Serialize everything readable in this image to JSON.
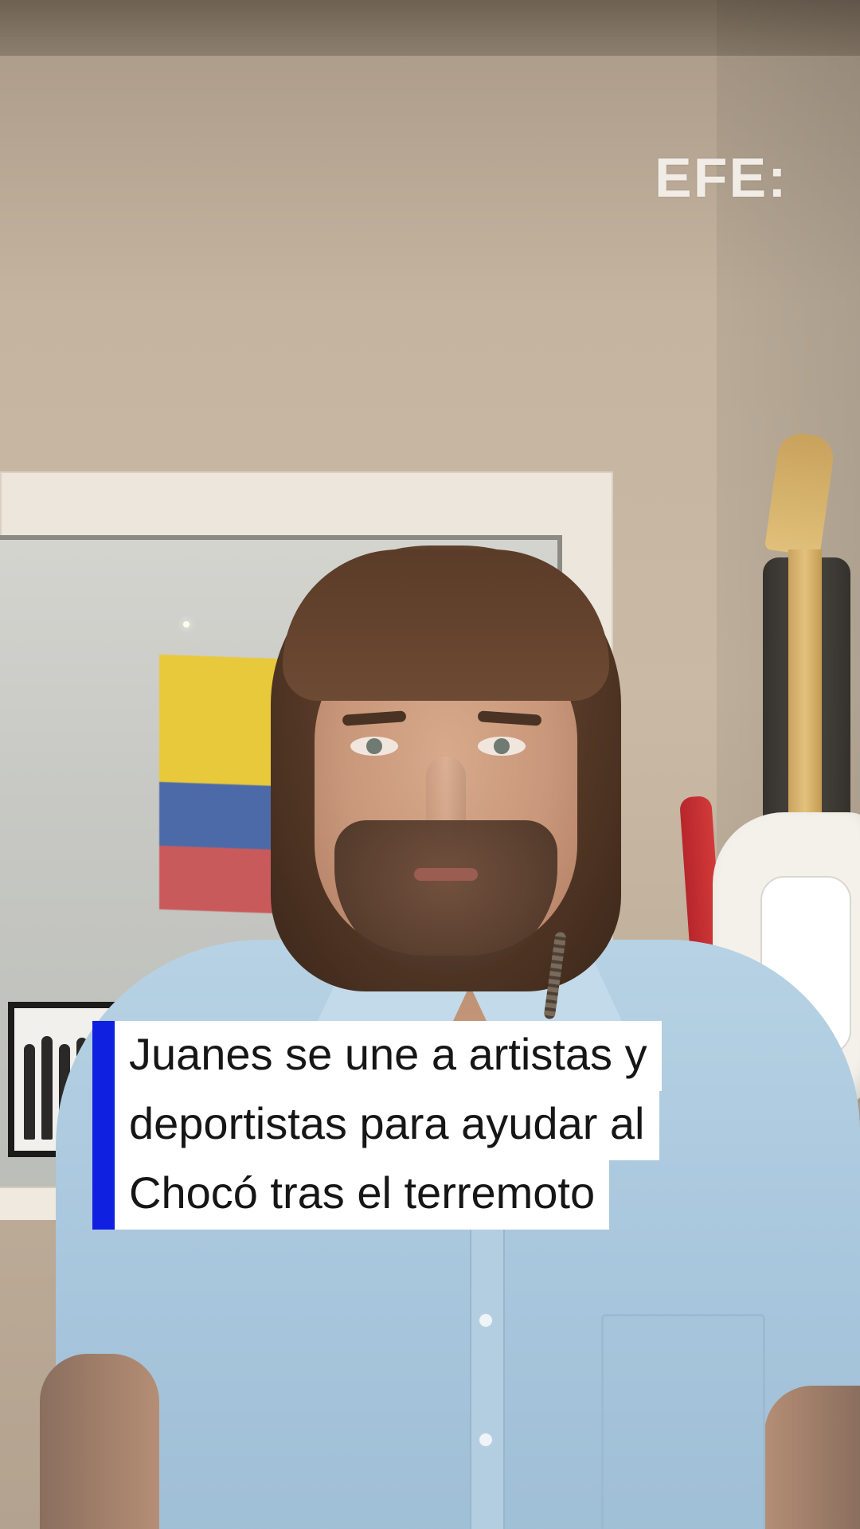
{
  "logo": {
    "text": "EFE:"
  },
  "caption": {
    "lines": [
      "Juanes se une a artistas y",
      "deportistas para ayudar al",
      "Chocó tras el terremoto"
    ],
    "accent_color": "#1020e0",
    "background_color": "#ffffff"
  },
  "scene": {
    "flag_colors": [
      "#e7c93b",
      "#4d6aa8",
      "#c95a5c"
    ],
    "shirt_color": "#a9c7dd"
  }
}
